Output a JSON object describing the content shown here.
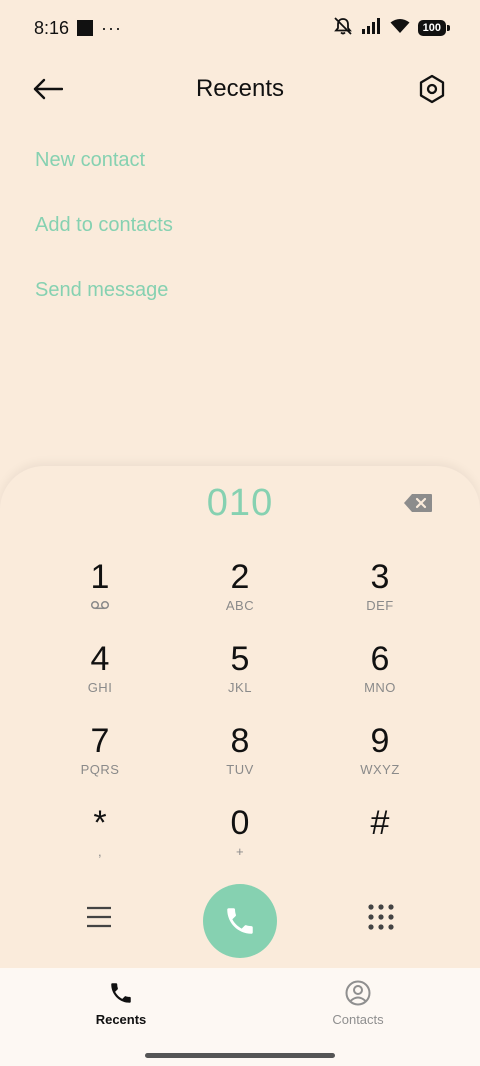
{
  "status_bar": {
    "time": "8:16",
    "dots": "···",
    "battery": "100"
  },
  "header": {
    "title": "Recents"
  },
  "options": [
    {
      "label": "New contact"
    },
    {
      "label": "Add to contacts"
    },
    {
      "label": "Send message"
    }
  ],
  "dialer": {
    "number": "010",
    "keys": [
      {
        "digit": "1",
        "letters": ""
      },
      {
        "digit": "2",
        "letters": "ABC"
      },
      {
        "digit": "3",
        "letters": "DEF"
      },
      {
        "digit": "4",
        "letters": "GHI"
      },
      {
        "digit": "5",
        "letters": "JKL"
      },
      {
        "digit": "6",
        "letters": "MNO"
      },
      {
        "digit": "7",
        "letters": "PQRS"
      },
      {
        "digit": "8",
        "letters": "TUV"
      },
      {
        "digit": "9",
        "letters": "WXYZ"
      },
      {
        "digit": "*",
        "letters": ","
      },
      {
        "digit": "0",
        "letters": "+"
      },
      {
        "digit": "#",
        "letters": ""
      }
    ]
  },
  "nav": {
    "recents": "Recents",
    "contacts": "Contacts"
  },
  "colors": {
    "accent": "#86D1B1",
    "background": "#FAEBDB"
  },
  "icons": {
    "back": "arrow-left-icon",
    "settings": "hexagon-settings-icon",
    "backspace": "backspace-icon",
    "voicemail": "voicemail-icon",
    "menu": "menu-icon",
    "call": "phone-icon",
    "keypad": "dialpad-icon",
    "contacts": "person-circle-icon"
  }
}
